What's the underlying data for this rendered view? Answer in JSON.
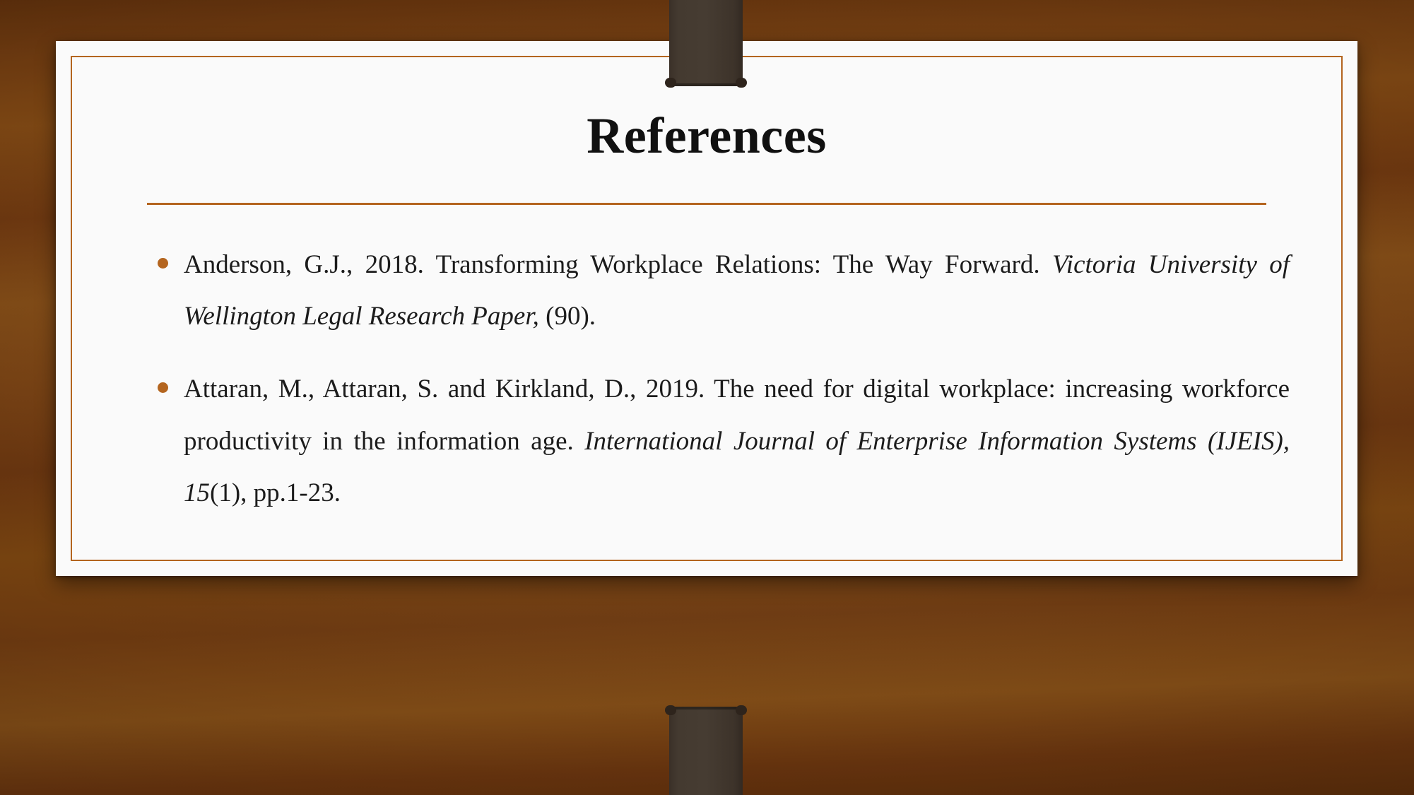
{
  "slide": {
    "title": "References",
    "theme": {
      "accent_color": "#b4651f",
      "card_color": "#fafafa",
      "background_color": "#74400f",
      "clip_color": "#443a30",
      "text_color": "#1c1c1c",
      "title_color": "#101010"
    },
    "references": [
      {
        "bullet": "•",
        "segments": [
          {
            "text": "Anderson, G.J., 2018. Transforming Workplace Relations: The Way Forward. ",
            "style": "normal"
          },
          {
            "text": "Victoria University of Wellington Legal Research Paper,",
            "style": "italic"
          },
          {
            "text": " (90).",
            "style": "normal"
          }
        ],
        "plain": "Anderson, G.J., 2018. Transforming Workplace Relations: The Way Forward. Victoria University of Wellington Legal Research Paper, (90)."
      },
      {
        "bullet": "•",
        "segments": [
          {
            "text": "Attaran, M., Attaran, S. and Kirkland, D., 2019. The need for digital workplace: increasing workforce productivity in the information age. ",
            "style": "normal"
          },
          {
            "text": "International Journal of Enterprise Information Systems (IJEIS), 15",
            "style": "italic"
          },
          {
            "text": "(1), pp.1-23.",
            "style": "normal"
          }
        ],
        "plain": "Attaran, M., Attaran, S. and Kirkland, D., 2019. The need for digital workplace: increasing workforce productivity in the information age. International Journal of Enterprise Information Systems (IJEIS), 15(1), pp.1-23."
      }
    ]
  }
}
